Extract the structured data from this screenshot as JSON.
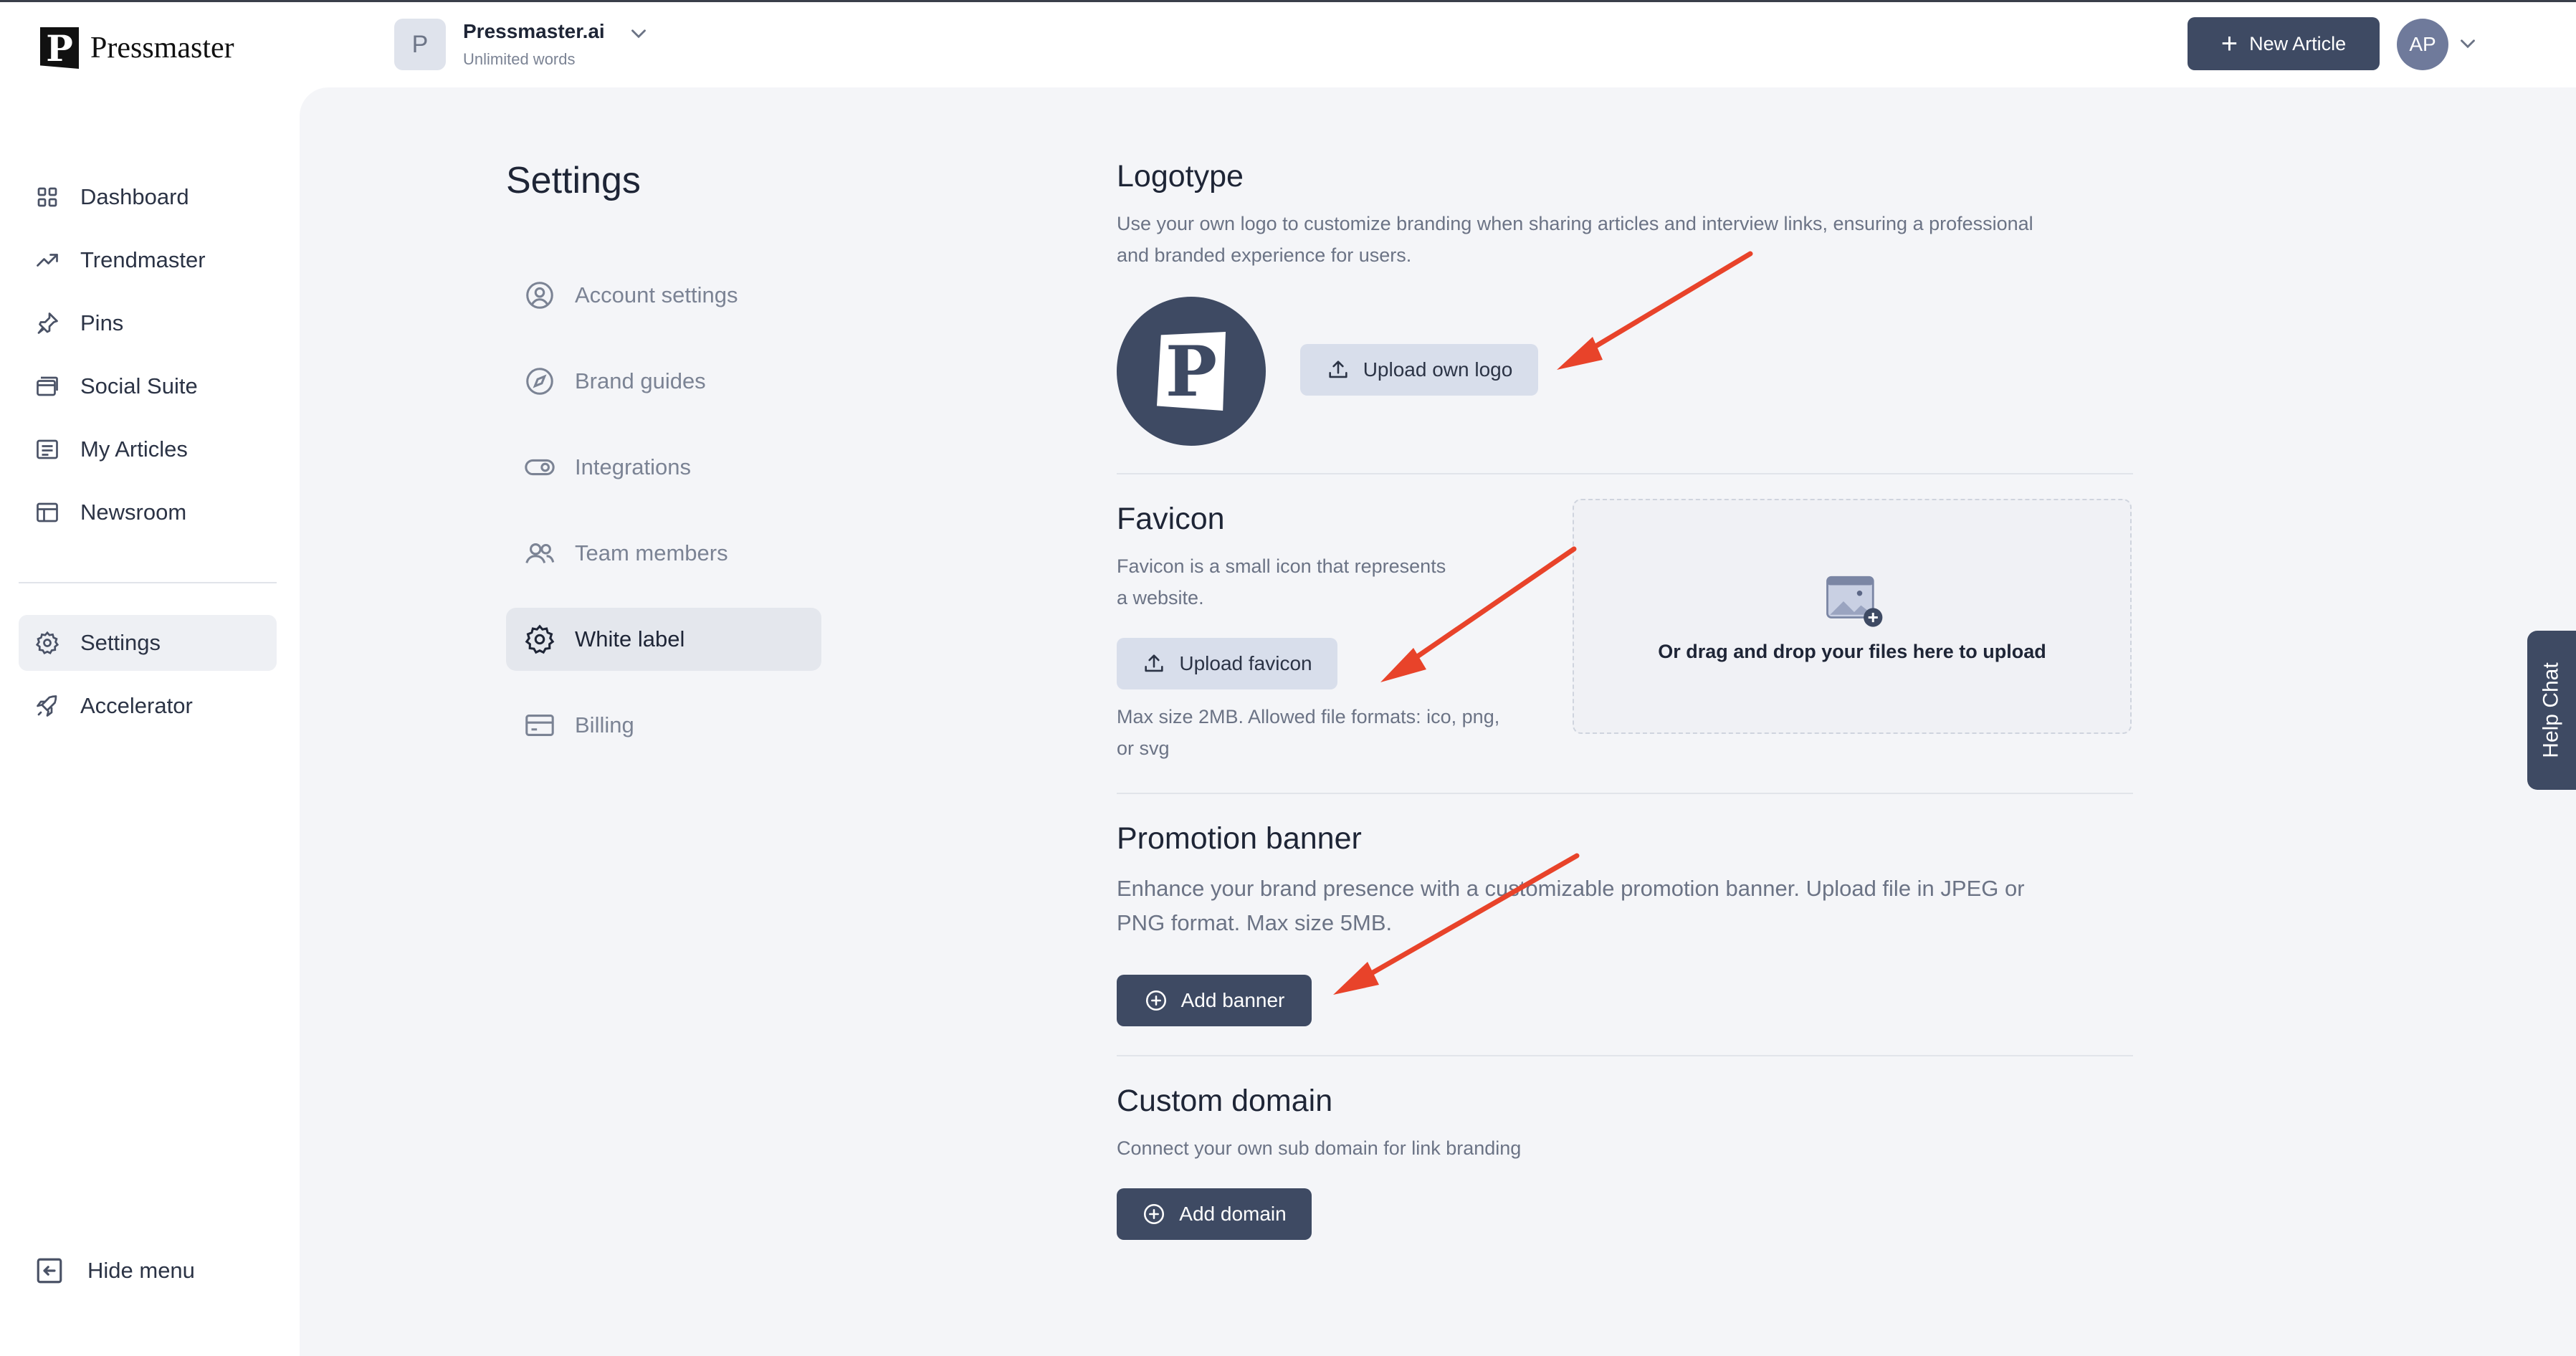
{
  "app": {
    "brand_name": "Pressmaster",
    "brand_initial": "P"
  },
  "workspace": {
    "initial": "P",
    "name": "Pressmaster.ai",
    "plan": "Unlimited words"
  },
  "header": {
    "new_article_label": "New Article",
    "user_initials": "AP"
  },
  "sidebar": {
    "items": [
      {
        "label": "Dashboard",
        "icon": "grid-icon"
      },
      {
        "label": "Trendmaster",
        "icon": "trending-up-icon"
      },
      {
        "label": "Pins",
        "icon": "pin-icon"
      },
      {
        "label": "Social Suite",
        "icon": "stack-icon"
      },
      {
        "label": "My Articles",
        "icon": "article-icon"
      },
      {
        "label": "Newsroom",
        "icon": "layout-icon"
      }
    ],
    "secondary": [
      {
        "label": "Settings",
        "icon": "gear-icon",
        "active": true
      },
      {
        "label": "Accelerator",
        "icon": "rocket-icon"
      }
    ],
    "hide_menu_label": "Hide menu"
  },
  "settings": {
    "title": "Settings",
    "nav": [
      {
        "label": "Account settings",
        "icon": "user-circle-icon"
      },
      {
        "label": "Brand guides",
        "icon": "compass-icon"
      },
      {
        "label": "Integrations",
        "icon": "toggle-icon"
      },
      {
        "label": "Team members",
        "icon": "users-icon"
      },
      {
        "label": "White label",
        "icon": "gear-icon",
        "active": true
      },
      {
        "label": "Billing",
        "icon": "card-icon"
      }
    ]
  },
  "white_label": {
    "logotype": {
      "title": "Logotype",
      "desc_line1": "Use your own logo to customize branding when sharing articles and interview links, ensuring a professional",
      "desc_line2": "and branded experience for users.",
      "upload_label": "Upload own logo",
      "preview_letter": "P"
    },
    "favicon": {
      "title": "Favicon",
      "desc_line1": "Favicon is a small icon that represents",
      "desc_line2": "a website.",
      "upload_label": "Upload favicon",
      "hint_line1": "Max size 2MB. Allowed file formats: ico, png,",
      "hint_line2": "or svg",
      "dropzone_text": "Or drag and drop your files here to upload"
    },
    "promotion_banner": {
      "title": "Promotion banner",
      "desc_line1": "Enhance your brand presence with a customizable promotion banner. Upload file in JPEG or",
      "desc_line2": "PNG format. Max size 5MB.",
      "button_label": "Add banner"
    },
    "custom_domain": {
      "title": "Custom domain",
      "desc": "Connect your own sub domain for link branding",
      "button_label": "Add domain"
    }
  },
  "help_chat": {
    "label": "Help Chat"
  },
  "colors": {
    "primary": "#3e4a63",
    "light_button": "#d8deeb",
    "panel_bg": "#f4f5f8",
    "annotation_arrow": "#e8432a"
  }
}
